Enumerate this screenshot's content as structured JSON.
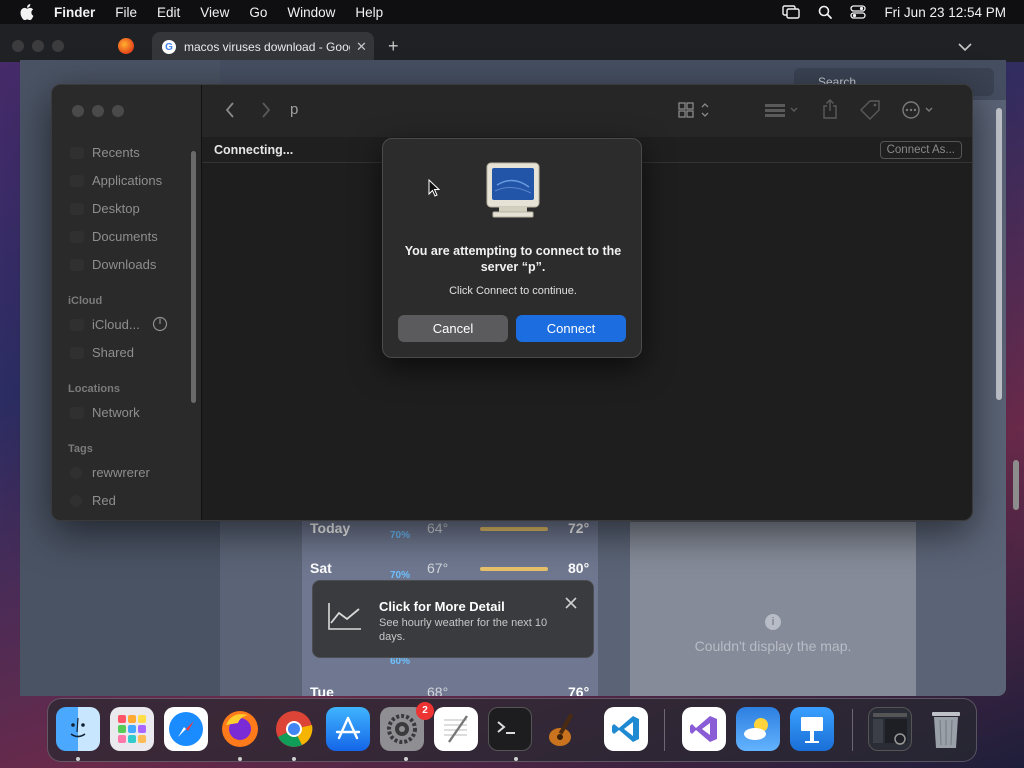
{
  "menubar": {
    "app": "Finder",
    "items": [
      "File",
      "Edit",
      "View",
      "Go",
      "Window",
      "Help"
    ],
    "clock": "Fri Jun 23  12:54 PM"
  },
  "browser": {
    "tab_title": "macos viruses download - Goog",
    "tab_icon": "G",
    "search_placeholder": "Search"
  },
  "weather": {
    "rows": [
      {
        "day": "Today",
        "precip": "70%",
        "low": "64°",
        "high": "72°"
      },
      {
        "day": "Sat",
        "precip": "70%",
        "low": "67°",
        "high": "80°"
      },
      {
        "day": "Tue",
        "precip": "",
        "low": "68°",
        "high": "76°"
      }
    ],
    "extra_precip": "60%",
    "popover_title": "Click for More Detail",
    "popover_desc": "See hourly weather for the next 10 days.",
    "map_message": "Couldn't display the map.",
    "map_info_glyph": "i"
  },
  "finder": {
    "path": "p",
    "status": "Connecting...",
    "connect_as": "Connect As...",
    "sidebar": {
      "favorites": [
        "Recents",
        "Applications",
        "Desktop",
        "Documents",
        "Downloads"
      ],
      "icloud_head": "iCloud",
      "icloud": [
        "iCloud...",
        "Shared"
      ],
      "locations_head": "Locations",
      "locations": [
        "Network"
      ],
      "tags_head": "Tags",
      "tags": [
        "rewwrerer",
        "Red"
      ]
    }
  },
  "dialog": {
    "message": "You are attempting to connect to the server “p”.",
    "sub": "Click Connect to continue.",
    "cancel": "Cancel",
    "connect": "Connect"
  },
  "dock": {
    "settings_badge": "2",
    "apps": [
      "finder",
      "launchpad",
      "safari",
      "firefox",
      "chrome",
      "app-store",
      "system-settings",
      "textedit",
      "terminal",
      "garageband",
      "vscode",
      "visual-studio",
      "weather",
      "keynote",
      "window-thumbnail",
      "trash"
    ]
  },
  "colors": {
    "accent": "#1c6ee0",
    "badge": "#e33333"
  }
}
